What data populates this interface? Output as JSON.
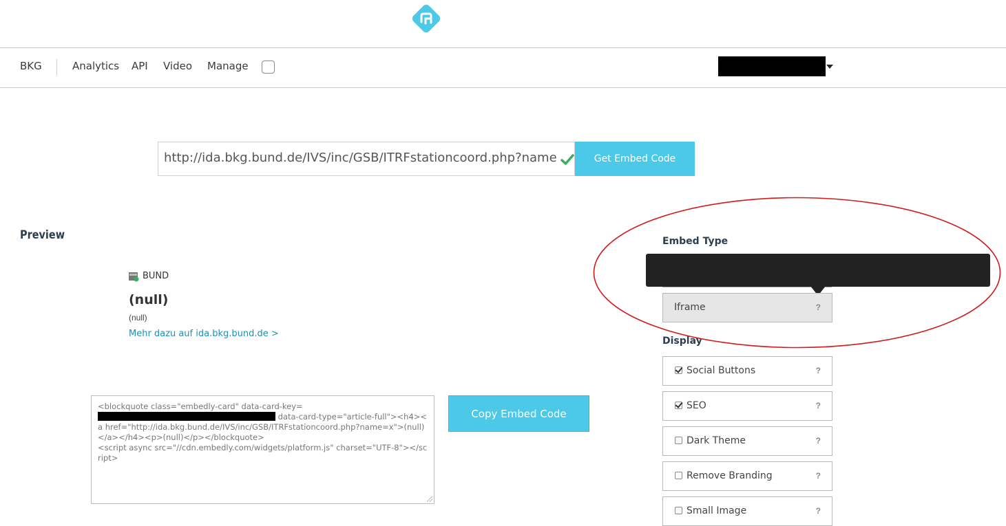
{
  "nav": {
    "items": [
      "BKG",
      "Analytics",
      "API",
      "Video",
      "Manage"
    ]
  },
  "url_input": {
    "value": "http://ida.bkg.bund.de/IVS/inc/GSB/ITRFstationcoord.php?name=x"
  },
  "get_embed_button": "Get Embed Code",
  "preview": {
    "heading": "Preview",
    "provider": "BUND",
    "title": "(null)",
    "description": "(null)",
    "link": "Mehr dazu auf ida.bkg.bund.de >"
  },
  "embed_code": {
    "part1": "<blockquote class=\"embedly-card\" data-card-key=",
    "part2": " data-card-type=\"article-full\"><h4><a href=\"http://ida.bkg.bund.de/IVS/inc/GSB/ITRFstationcoord.php?name=x\">(null)</a></h4><p>(null)</p></blockquote>",
    "part3": "<script async src=\"//cdn.embedly.com/widgets/platform.js\" charset=\"UTF-8\"></script>"
  },
  "copy_button": "Copy Embed Code",
  "embed_type": {
    "heading": "Embed Type",
    "selected": "Iframe",
    "help": "?"
  },
  "display": {
    "heading": "Display",
    "options": [
      {
        "label": "Social Buttons",
        "checked": true,
        "help": "?"
      },
      {
        "label": "SEO",
        "checked": true,
        "help": "?"
      },
      {
        "label": "Dark Theme",
        "checked": false,
        "help": "?"
      },
      {
        "label": "Remove Branding",
        "checked": false,
        "help": "?"
      },
      {
        "label": "Small Image",
        "checked": false,
        "help": "?"
      }
    ]
  },
  "colors": {
    "accent": "#4cc8e8",
    "link": "#1d8fb3",
    "annotation": "#d11a1a",
    "check_green": "#3bae5e"
  }
}
